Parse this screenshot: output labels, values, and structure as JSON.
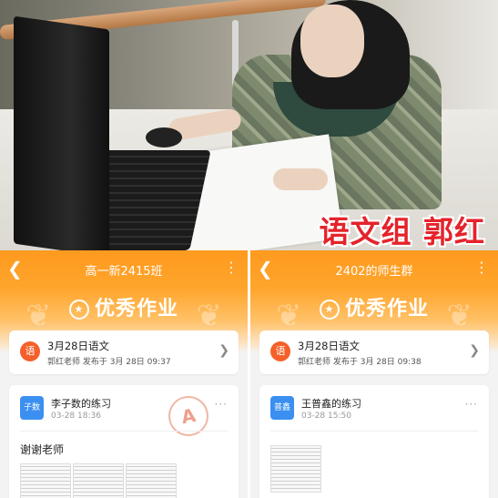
{
  "photo": {
    "caption": "语文组 郭红"
  },
  "left_panel": {
    "title": "高一新2415班",
    "banner": "优秀作业",
    "assignment": {
      "icon_label": "语",
      "title": "3月28日语文",
      "meta": "郭红老师 发布于 3月 28日 09:37"
    },
    "post": {
      "avatar_label": "子数",
      "name": "李子数的练习",
      "time": "03-28 18:36",
      "message": "谢谢老师",
      "stamp": "A"
    }
  },
  "right_panel": {
    "title": "2402的师生群",
    "banner": "优秀作业",
    "assignment": {
      "icon_label": "语",
      "title": "3月28日语文",
      "meta": "郭红老师 发布于 3月 28日 09:38"
    },
    "post": {
      "avatar_label": "普鑫",
      "name": "王普鑫的练习",
      "time": "03-28 15:50"
    }
  },
  "colors": {
    "header_orange": "#ff9a1e",
    "assignment_icon": "#f5602a",
    "avatar_blue": "#3b8ff0",
    "caption_red": "#e5232b"
  }
}
